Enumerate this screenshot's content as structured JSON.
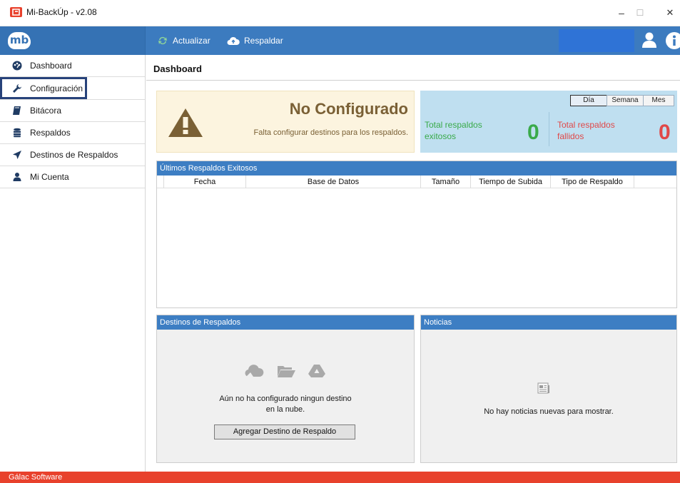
{
  "window": {
    "title": "Mi-BackÚp - v2.08",
    "minimize_glyph": "–",
    "maximize_glyph": "☐",
    "close_glyph": "✕"
  },
  "toolbar": {
    "logo_text": "mb",
    "refresh_label": "Actualizar",
    "backup_label": "Respaldar",
    "refresh_icon": "refresh-icon",
    "backup_icon": "cloud-upload-icon",
    "user_icon": "user-icon",
    "info_icon": "info-icon"
  },
  "sidebar": {
    "items": [
      {
        "label": "Dashboard",
        "icon": "dashboard-icon"
      },
      {
        "label": "Configuración",
        "icon": "wrench-icon"
      },
      {
        "label": "Bitácora",
        "icon": "book-icon"
      },
      {
        "label": "Respaldos",
        "icon": "database-icon"
      },
      {
        "label": "Destinos de Respaldos",
        "icon": "send-icon"
      },
      {
        "label": "Mi Cuenta",
        "icon": "user-icon"
      }
    ]
  },
  "main": {
    "title": "Dashboard",
    "warning": {
      "title": "No Configurado",
      "message": "Falta configurar destinos para los respaldos."
    },
    "stats": {
      "tabs": [
        "Día",
        "Semana",
        "Mes"
      ],
      "active_tab": "Día",
      "success_label_1": "Total respaldos",
      "success_label_2": "exitosos",
      "success_value": "0",
      "failed_label_1": "Total respaldos",
      "failed_label_2": "fallidos",
      "failed_value": "0"
    },
    "recent": {
      "header": "Últimos Respaldos Exitosos",
      "columns": [
        "Fecha",
        "Base de Datos",
        "Tamaño",
        "Tiempo de Subida",
        "Tipo de Respaldo"
      ]
    },
    "destinations": {
      "header": "Destinos de Respaldos",
      "empty_line_1": "Aún no ha configurado ningun destino",
      "empty_line_2": "en la nube.",
      "add_button": "Agregar Destino de Respaldo"
    },
    "news": {
      "header": "Noticias",
      "empty": "No hay noticias nuevas para mostrar."
    }
  },
  "footer": {
    "text": "Gálac Software"
  },
  "colors": {
    "accent": "#3c7bbf",
    "brand_red": "#e8412c",
    "success": "#3aaa4a",
    "danger": "#e04848",
    "warning_bg": "#fcf4df"
  }
}
